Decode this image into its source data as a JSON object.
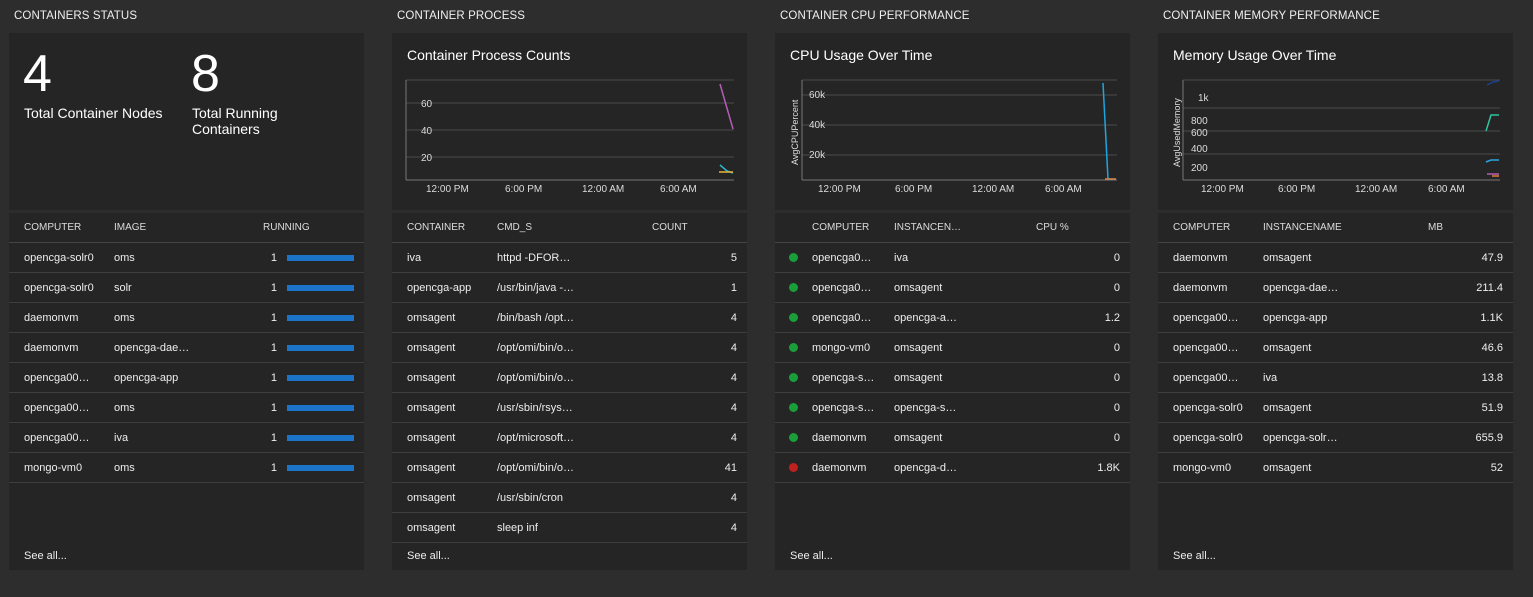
{
  "sections": {
    "status": "CONTAINERS STATUS",
    "process": "CONTAINER PROCESS",
    "cpu": "CONTAINER CPU PERFORMANCE",
    "memory": "CONTAINER MEMORY PERFORMANCE"
  },
  "status_tile": {
    "nodes_value": "4",
    "nodes_label": "Total Container Nodes",
    "running_value": "8",
    "running_label": "Total Running Containers"
  },
  "process_chart": {
    "title": "Container Process Counts",
    "yticks": [
      "60",
      "40",
      "20"
    ],
    "xticks": [
      "12:00 PM",
      "6:00 PM",
      "12:00 AM",
      "6:00 AM"
    ],
    "colors": [
      "#b45fb4",
      "#2cb5c8",
      "#e8b33a"
    ]
  },
  "cpu_chart": {
    "title": "CPU Usage Over Time",
    "ylabel": "AvgCPUPercent",
    "yticks": [
      "60k",
      "40k",
      "20k"
    ],
    "xticks": [
      "12:00 PM",
      "6:00 PM",
      "12:00 AM",
      "6:00 AM"
    ],
    "colors": [
      "#1ea5e0",
      "#e07a3a"
    ]
  },
  "mem_chart": {
    "title": "Memory Usage Over Time",
    "ylabel": "AvgUsedMemory",
    "yticks": [
      "1k",
      "800",
      "600",
      "400",
      "200"
    ],
    "xticks": [
      "12:00 PM",
      "6:00 PM",
      "12:00 AM",
      "6:00 AM"
    ],
    "colors": [
      "#2ec4a0",
      "#29a8e0",
      "#1e3f8a",
      "#e07a3a",
      "#b45fb4"
    ]
  },
  "status_table": {
    "headers": [
      "COMPUTER",
      "IMAGE",
      "RUNNING"
    ],
    "rows": [
      {
        "computer": "opencga-solr0",
        "image": "oms",
        "running": "1",
        "fill": 1
      },
      {
        "computer": "opencga-solr0",
        "image": "solr",
        "running": "1",
        "fill": 1
      },
      {
        "computer": "daemonvm",
        "image": "oms",
        "running": "1",
        "fill": 1
      },
      {
        "computer": "daemonvm",
        "image": "opencga-dae…",
        "running": "1",
        "fill": 1
      },
      {
        "computer": "opencga00…",
        "image": "opencga-app",
        "running": "1",
        "fill": 1
      },
      {
        "computer": "opencga00…",
        "image": "oms",
        "running": "1",
        "fill": 1
      },
      {
        "computer": "opencga00…",
        "image": "iva",
        "running": "1",
        "fill": 1
      },
      {
        "computer": "mongo-vm0",
        "image": "oms",
        "running": "1",
        "fill": 1
      }
    ],
    "see_all": "See all..."
  },
  "process_table": {
    "headers": [
      "CONTAINER",
      "CMD_S",
      "COUNT"
    ],
    "rows": [
      {
        "container": "iva",
        "cmd": "httpd -DFOR…",
        "count": "5"
      },
      {
        "container": "opencga-app",
        "cmd": "/usr/bin/java -…",
        "count": "1"
      },
      {
        "container": "omsagent",
        "cmd": "/bin/bash /opt…",
        "count": "4"
      },
      {
        "container": "omsagent",
        "cmd": "/opt/omi/bin/o…",
        "count": "4"
      },
      {
        "container": "omsagent",
        "cmd": "/opt/omi/bin/o…",
        "count": "4"
      },
      {
        "container": "omsagent",
        "cmd": "/usr/sbin/rsys…",
        "count": "4"
      },
      {
        "container": "omsagent",
        "cmd": "/opt/microsoft…",
        "count": "4"
      },
      {
        "container": "omsagent",
        "cmd": "/opt/omi/bin/o…",
        "count": "41"
      },
      {
        "container": "omsagent",
        "cmd": "/usr/sbin/cron",
        "count": "4"
      },
      {
        "container": "omsagent",
        "cmd": "sleep inf",
        "count": "4"
      }
    ],
    "see_all": "See all..."
  },
  "cpu_table": {
    "headers": [
      "COMPUTER",
      "INSTANCEN…",
      "CPU %"
    ],
    "rows": [
      {
        "status": "#1a9e3a",
        "computer": "opencga0…",
        "instance": "iva",
        "cpu": "0"
      },
      {
        "status": "#1a9e3a",
        "computer": "opencga0…",
        "instance": "omsagent",
        "cpu": "0"
      },
      {
        "status": "#1a9e3a",
        "computer": "opencga0…",
        "instance": "opencga-a…",
        "cpu": "1.2"
      },
      {
        "status": "#1a9e3a",
        "computer": "mongo-vm0",
        "instance": "omsagent",
        "cpu": "0"
      },
      {
        "status": "#1a9e3a",
        "computer": "opencga-s…",
        "instance": "omsagent",
        "cpu": "0"
      },
      {
        "status": "#1a9e3a",
        "computer": "opencga-s…",
        "instance": "opencga-s…",
        "cpu": "0"
      },
      {
        "status": "#1a9e3a",
        "computer": "daemonvm",
        "instance": "omsagent",
        "cpu": "0"
      },
      {
        "status": "#c0211f",
        "computer": "daemonvm",
        "instance": "opencga-d…",
        "cpu": "1.8K"
      }
    ],
    "see_all": "See all..."
  },
  "mem_table": {
    "headers": [
      "COMPUTER",
      "INSTANCENAME",
      "MB"
    ],
    "rows": [
      {
        "computer": "daemonvm",
        "instance": "omsagent",
        "mb": "47.9"
      },
      {
        "computer": "daemonvm",
        "instance": "opencga-dae…",
        "mb": "211.4"
      },
      {
        "computer": "opencga00…",
        "instance": "opencga-app",
        "mb": "1.1K"
      },
      {
        "computer": "opencga00…",
        "instance": "omsagent",
        "mb": "46.6"
      },
      {
        "computer": "opencga00…",
        "instance": "iva",
        "mb": "13.8"
      },
      {
        "computer": "opencga-solr0",
        "instance": "omsagent",
        "mb": "51.9"
      },
      {
        "computer": "opencga-solr0",
        "instance": "opencga-solr…",
        "mb": "655.9"
      },
      {
        "computer": "mongo-vm0",
        "instance": "omsagent",
        "mb": "52"
      }
    ],
    "see_all": "See all..."
  }
}
